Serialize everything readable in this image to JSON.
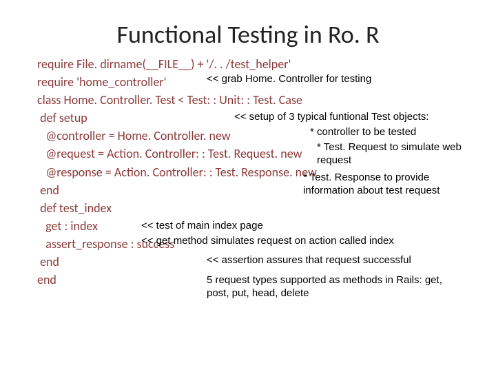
{
  "title": "Functional Testing in Ro. R",
  "code": {
    "l1": "require File. dirname(__FILE__) + '/. . /test_helper'",
    "l2": "require 'home_controller'",
    "l3": "class Home. Controller. Test < Test: : Unit: : Test. Case",
    "l4": " def setup",
    "l5": "   @controller = Home. Controller. new",
    "l6": "   @request = Action. Controller: : Test. Request. new",
    "l7": "   @response = Action. Controller: : Test. Response. new",
    "l8": " end",
    "l9": " def test_index",
    "l10": "   get : index",
    "l11": "   assert_response : success",
    "l12": " end",
    "l13": "end"
  },
  "annotations": {
    "grab": "<< grab Home. Controller for testing",
    "setup": "<< setup of 3 typical funtional Test objects:",
    "controller": "* controller to be tested",
    "request": "* Test. Request to simulate web request",
    "response": "* Test. Response to provide information about test request",
    "testmain": "<< test of main index page",
    "getmethod": "<< get method simulates request on action called index",
    "assert": "<< assertion assures that request successful",
    "fivereq": "5 request types supported as methods in Rails: get, post, put, head, delete"
  }
}
